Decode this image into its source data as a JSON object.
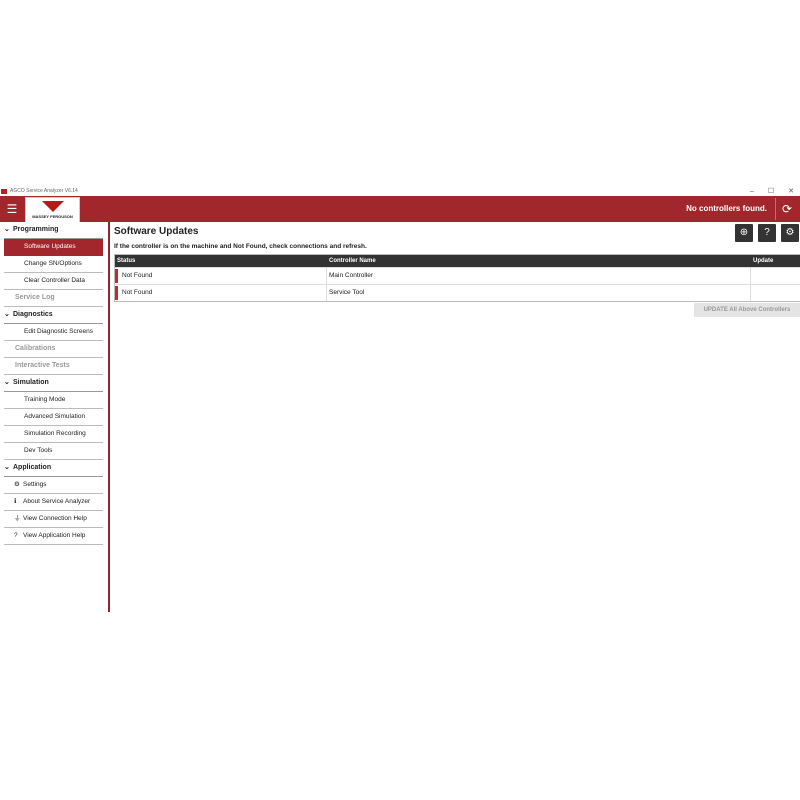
{
  "window": {
    "title": "AGCO Service Analyzer V6.14",
    "minimize": "–",
    "maximize": "☐",
    "close": "✕"
  },
  "header": {
    "menu_icon": "☰",
    "brand": "MASSEY FERGUSON",
    "status": "No controllers found.",
    "refresh_icon": "⟳"
  },
  "sidebar": {
    "programming": {
      "label": "Programming",
      "chev": "⌄",
      "items": [
        "Software Updates",
        "Change SN/Options",
        "Clear Controller Data"
      ]
    },
    "service_log": "Service Log",
    "diagnostics": {
      "label": "Diagnostics",
      "chev": "⌄",
      "items": [
        "Edit Diagnostic Screens"
      ]
    },
    "calibrations": "Calibrations",
    "interactive_tests": "Interactive Tests",
    "simulation": {
      "label": "Simulation",
      "chev": "⌄",
      "items": [
        "Training Mode",
        "Advanced Simulation",
        "Simulation Recording",
        "Dev Tools"
      ]
    },
    "application": {
      "label": "Application",
      "chev": "⌄",
      "items": [
        {
          "icon": "⚙",
          "label": "Settings"
        },
        {
          "icon": "ℹ",
          "label": "About Service Analyzer"
        },
        {
          "icon": "⏚",
          "label": "View Connection Help"
        },
        {
          "icon": "?",
          "label": "View Application Help"
        }
      ]
    }
  },
  "main": {
    "title": "Software Updates",
    "subtitle": "If the controller is on the machine and Not Found, check connections and refresh.",
    "toolbar": {
      "zoom_icon": "⊕",
      "help_icon": "?",
      "settings_icon": "⚙"
    },
    "table": {
      "headers": [
        "Status",
        "Controller Name",
        "Update"
      ],
      "rows": [
        {
          "status": "Not Found",
          "name": "Main Controller",
          "update": ""
        },
        {
          "status": "Not Found",
          "name": "Service Tool",
          "update": ""
        }
      ]
    },
    "update_button": "UPDATE All Above Controllers"
  },
  "colors": {
    "brand": "#a1272d",
    "error": "#d0232a",
    "dark": "#333333"
  }
}
